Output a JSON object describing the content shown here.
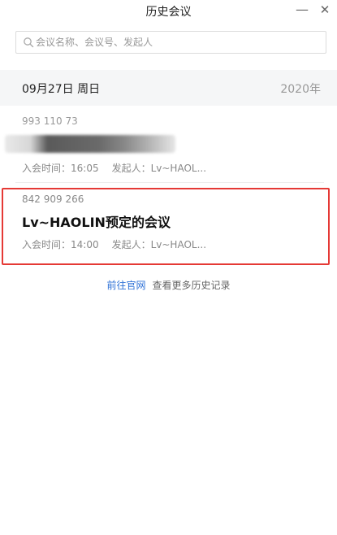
{
  "window": {
    "title": "历史会议",
    "minimize_label": "—",
    "close_label": "✕"
  },
  "search": {
    "placeholder": "会议名称、会议号、发起人",
    "value": ""
  },
  "date_group": {
    "date": "09月27日 周日",
    "year": "2020年"
  },
  "meetings": [
    {
      "number": "993 110 73",
      "name": "",
      "join_time": "入会时间：16:05",
      "initiator": "发起人：Lv~HAOL..."
    },
    {
      "number": "842 909 266",
      "name": "Lv~HAOLIN预定的会议",
      "join_time": "入会时间：14:00",
      "initiator": "发起人：Lv~HAOL..."
    }
  ],
  "footer": {
    "link_label": "前往官网",
    "text": "查看更多历史记录"
  },
  "colors": {
    "link": "#2b6fd6",
    "highlight": "#e53935"
  }
}
